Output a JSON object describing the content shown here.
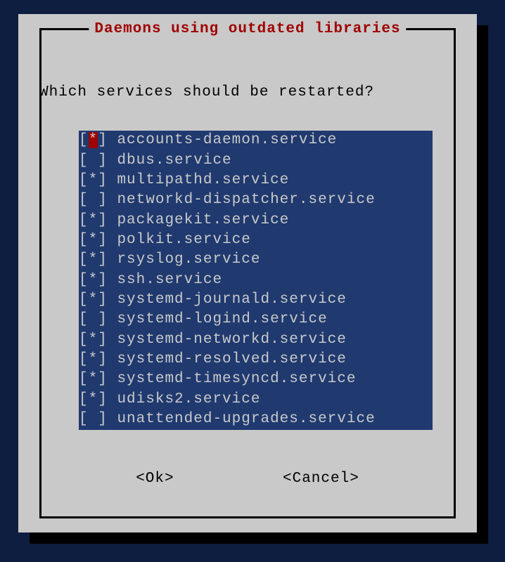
{
  "dialog": {
    "title": "Daemons using outdated libraries",
    "prompt": "Which services should be restarted?",
    "buttons": {
      "ok": "<Ok>",
      "cancel": "<Cancel>"
    }
  },
  "services": [
    {
      "name": "accounts-daemon.service",
      "checked": true,
      "focused": true
    },
    {
      "name": "dbus.service",
      "checked": false,
      "focused": false
    },
    {
      "name": "multipathd.service",
      "checked": true,
      "focused": false
    },
    {
      "name": "networkd-dispatcher.service",
      "checked": false,
      "focused": false
    },
    {
      "name": "packagekit.service",
      "checked": true,
      "focused": false
    },
    {
      "name": "polkit.service",
      "checked": true,
      "focused": false
    },
    {
      "name": "rsyslog.service",
      "checked": true,
      "focused": false
    },
    {
      "name": "ssh.service",
      "checked": true,
      "focused": false
    },
    {
      "name": "systemd-journald.service",
      "checked": true,
      "focused": false
    },
    {
      "name": "systemd-logind.service",
      "checked": false,
      "focused": false
    },
    {
      "name": "systemd-networkd.service",
      "checked": true,
      "focused": false
    },
    {
      "name": "systemd-resolved.service",
      "checked": true,
      "focused": false
    },
    {
      "name": "systemd-timesyncd.service",
      "checked": true,
      "focused": false
    },
    {
      "name": "udisks2.service",
      "checked": true,
      "focused": false
    },
    {
      "name": "unattended-upgrades.service",
      "checked": false,
      "focused": false
    }
  ],
  "list_width": 33
}
